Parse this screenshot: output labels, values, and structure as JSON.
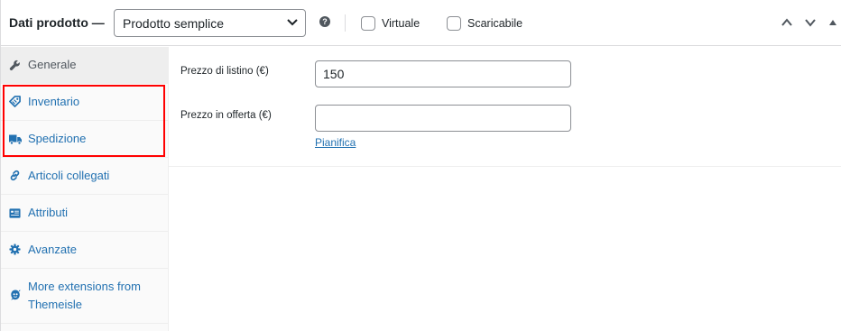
{
  "header": {
    "title": "Dati prodotto —",
    "product_type": "Prodotto semplice",
    "help": "?",
    "virtual_label": "Virtuale",
    "downloadable_label": "Scaricabile",
    "virtual_checked": false,
    "downloadable_checked": false
  },
  "tabs": [
    {
      "label": "Generale",
      "icon": "wrench-icon",
      "active": true
    },
    {
      "label": "Inventario",
      "icon": "tag-icon",
      "active": false
    },
    {
      "label": "Spedizione",
      "icon": "truck-icon",
      "active": false
    },
    {
      "label": "Articoli collegati",
      "icon": "link-icon",
      "active": false
    },
    {
      "label": "Attributi",
      "icon": "list-card-icon",
      "active": false
    },
    {
      "label": "Avanzate",
      "icon": "gear-icon",
      "active": false
    },
    {
      "label_line1": "More extensions from",
      "label_line2": "Themeisle",
      "icon": "themeisle-icon",
      "active": false
    }
  ],
  "general": {
    "regular_price_label": "Prezzo di listino (€)",
    "regular_price_value": "150",
    "sale_price_label": "Prezzo in offerta (€)",
    "sale_price_value": "",
    "schedule_link": "Pianifica"
  },
  "colors": {
    "link": "#2271b1",
    "highlight": "#ff0000",
    "border": "#dcdcde"
  }
}
